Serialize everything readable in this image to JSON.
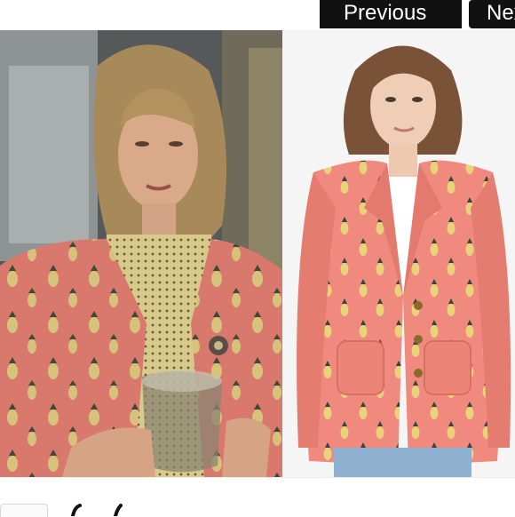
{
  "navigation": {
    "previous_label": "Previous",
    "next_label": "Next"
  },
  "images": {
    "left": {
      "icon": "tv-still-photo"
    },
    "right": {
      "icon": "product-model-photo"
    }
  },
  "colors": {
    "nav_background": "#111111",
    "nav_text": "#ffffff",
    "jacket_pink": "#f08a7e",
    "pineapple_yellow": "#e8d27a"
  }
}
